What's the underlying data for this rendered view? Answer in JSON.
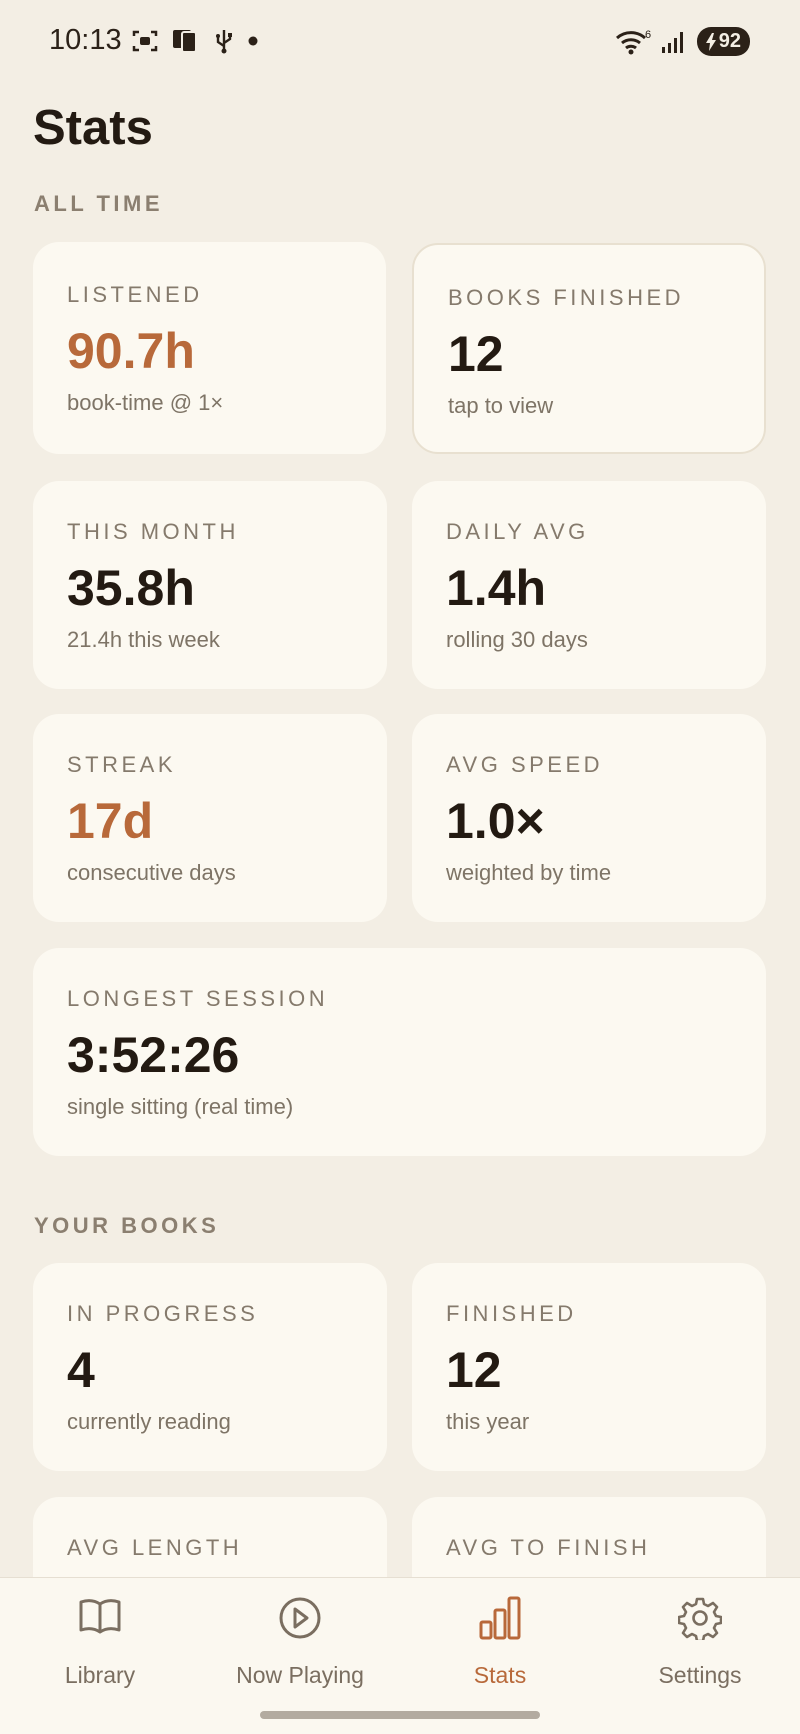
{
  "status_bar": {
    "time": "10:13",
    "battery": "92",
    "wifi_badge": "6"
  },
  "page": {
    "title": "Stats"
  },
  "sections": {
    "all_time": "ALL TIME",
    "your_books": "YOUR BOOKS"
  },
  "cards": {
    "listened": {
      "label": "LISTENED",
      "value": "90.7h",
      "sub": "book-time @ 1×"
    },
    "books_finished": {
      "label": "BOOKS FINISHED",
      "value": "12",
      "sub": "tap to view"
    },
    "this_month": {
      "label": "THIS MONTH",
      "value": "35.8h",
      "sub": "21.4h this week"
    },
    "daily_avg": {
      "label": "DAILY AVG",
      "value": "1.4h",
      "sub": "rolling 30 days"
    },
    "streak": {
      "label": "STREAK",
      "value": "17d",
      "sub": "consecutive days"
    },
    "avg_speed": {
      "label": "AVG SPEED",
      "value": "1.0×",
      "sub": "weighted by time"
    },
    "longest_session": {
      "label": "LONGEST SESSION",
      "value": "3:52:26",
      "sub": "single sitting (real time)"
    },
    "in_progress": {
      "label": "IN PROGRESS",
      "value": "4",
      "sub": "currently reading"
    },
    "finished": {
      "label": "FINISHED",
      "value": "12",
      "sub": "this year"
    },
    "avg_length": {
      "label": "AVG LENGTH"
    },
    "avg_to_finish": {
      "label": "AVG TO FINISH"
    }
  },
  "nav": {
    "library": "Library",
    "now_playing": "Now Playing",
    "stats": "Stats",
    "settings": "Settings"
  },
  "colors": {
    "accent": "#b8693a",
    "background": "#f3eee4",
    "card": "#fcf9f1",
    "text": "#231a12"
  }
}
